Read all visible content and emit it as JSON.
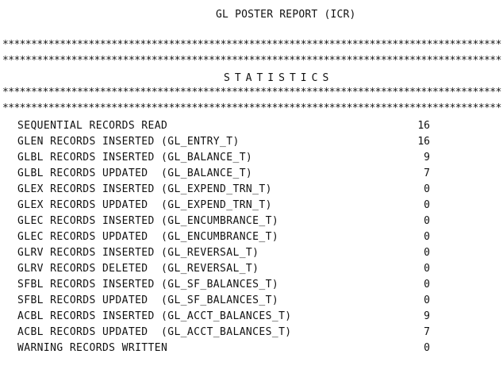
{
  "report": {
    "title": "GL POSTER REPORT (ICR)",
    "separator": "****************************************************************************************************",
    "section_title": "STATISTICS",
    "rows": [
      {
        "label": "SEQUENTIAL RECORDS READ",
        "value": "16"
      },
      {
        "label": "GLEN RECORDS INSERTED (GL_ENTRY_T)",
        "value": "16"
      },
      {
        "label": "GLBL RECORDS INSERTED (GL_BALANCE_T)",
        "value": "9"
      },
      {
        "label": "GLBL RECORDS UPDATED  (GL_BALANCE_T)",
        "value": "7"
      },
      {
        "label": "GLEX RECORDS INSERTED (GL_EXPEND_TRN_T)",
        "value": "0"
      },
      {
        "label": "GLEX RECORDS UPDATED  (GL_EXPEND_TRN_T)",
        "value": "0"
      },
      {
        "label": "GLEC RECORDS INSERTED (GL_ENCUMBRANCE_T)",
        "value": "0"
      },
      {
        "label": "GLEC RECORDS UPDATED  (GL_ENCUMBRANCE_T)",
        "value": "0"
      },
      {
        "label": "GLRV RECORDS INSERTED (GL_REVERSAL_T)",
        "value": "0"
      },
      {
        "label": "GLRV RECORDS DELETED  (GL_REVERSAL_T)",
        "value": "0"
      },
      {
        "label": "SFBL RECORDS INSERTED (GL_SF_BALANCES_T)",
        "value": "0"
      },
      {
        "label": "SFBL RECORDS UPDATED  (GL_SF_BALANCES_T)",
        "value": "0"
      },
      {
        "label": "ACBL RECORDS INSERTED (GL_ACCT_BALANCES_T)",
        "value": "9"
      },
      {
        "label": "ACBL RECORDS UPDATED  (GL_ACCT_BALANCES_T)",
        "value": "7"
      },
      {
        "label": "WARNING RECORDS WRITTEN",
        "value": "0"
      }
    ]
  }
}
